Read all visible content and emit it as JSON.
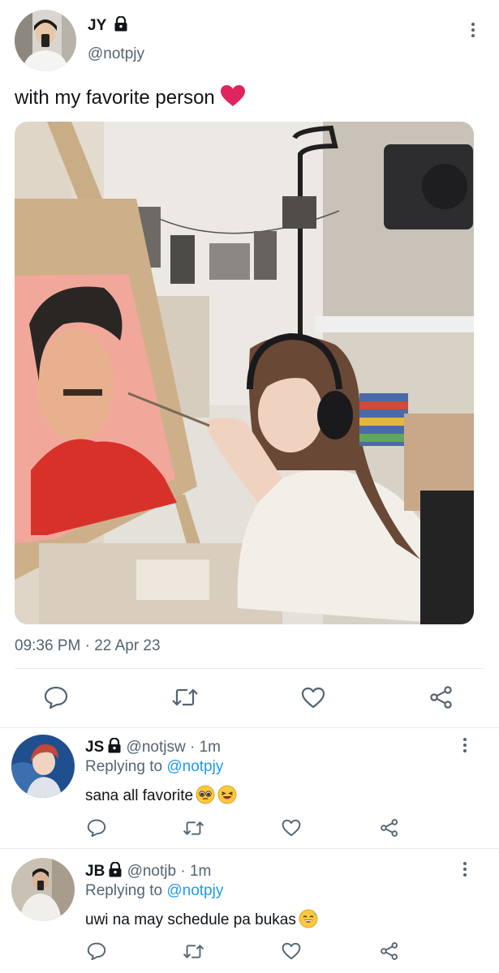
{
  "tweet": {
    "author_name": "JY",
    "author_handle": "@notpjy",
    "text": "with my favorite person",
    "timestamp": "09:36 PM · 22 Apr 23",
    "icons": [
      "lock-icon",
      "heart-emoji",
      "more-icon"
    ]
  },
  "actions": {
    "icons": [
      "reply-icon",
      "retweet-icon",
      "like-icon",
      "share-icon"
    ]
  },
  "replies": [
    {
      "name": "JS",
      "handle": "@notjsw",
      "separator": "·",
      "time": "1m",
      "replying_prefix": "Replying to",
      "replying_to": "@notpjy",
      "text": "sana all favorite"
    },
    {
      "name": "JB",
      "handle": "@notjb",
      "separator": "·",
      "time": "1m",
      "replying_prefix": "Replying to",
      "replying_to": "@notpjy",
      "text": "uwi na may schedule pa bukas"
    }
  ],
  "colors": {
    "text": "#0f1419",
    "secondary": "#536471",
    "link": "#1d9bf0",
    "divider": "#e6ecf0",
    "heart": "#e0245e"
  }
}
